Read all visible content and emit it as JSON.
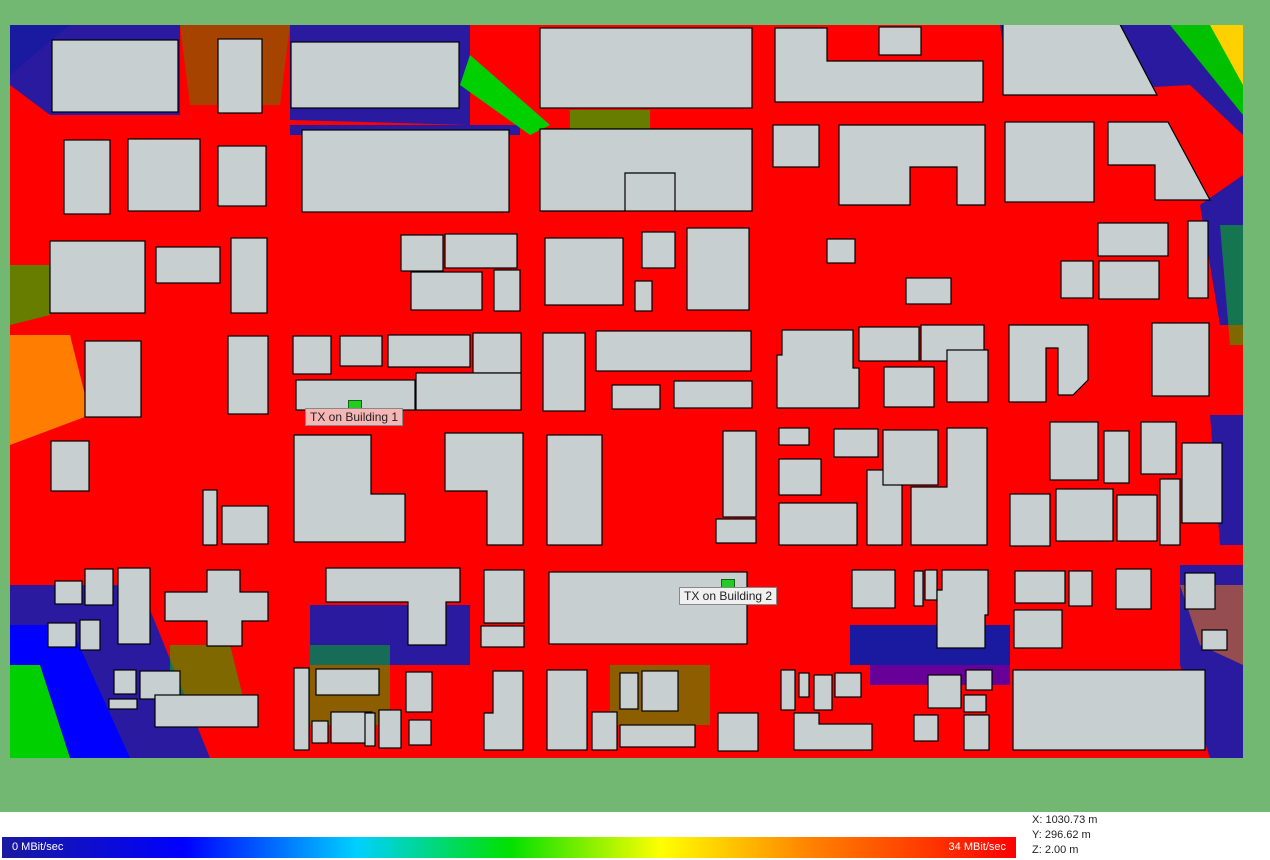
{
  "transmitters": [
    {
      "label": "TX on Building 1"
    },
    {
      "label": "TX on Building 2"
    }
  ],
  "legend": {
    "min_label": "0 MBit/sec",
    "max_label": "34 MBit/sec",
    "colors": [
      "#1a1aa0",
      "#0000ff",
      "#00d0ff",
      "#00e000",
      "#ffff00",
      "#ff8000",
      "#ff0000"
    ]
  },
  "cursor": {
    "x": "X: 1030.73 m",
    "y": "Y: 296.62 m",
    "z": "Z: 2.00 m"
  },
  "colors": {
    "background_frame": "#72b872",
    "coverage_high": "#ff0000",
    "building_fill": "#c8cfd0",
    "shadow_low": "#2a1aa0"
  }
}
